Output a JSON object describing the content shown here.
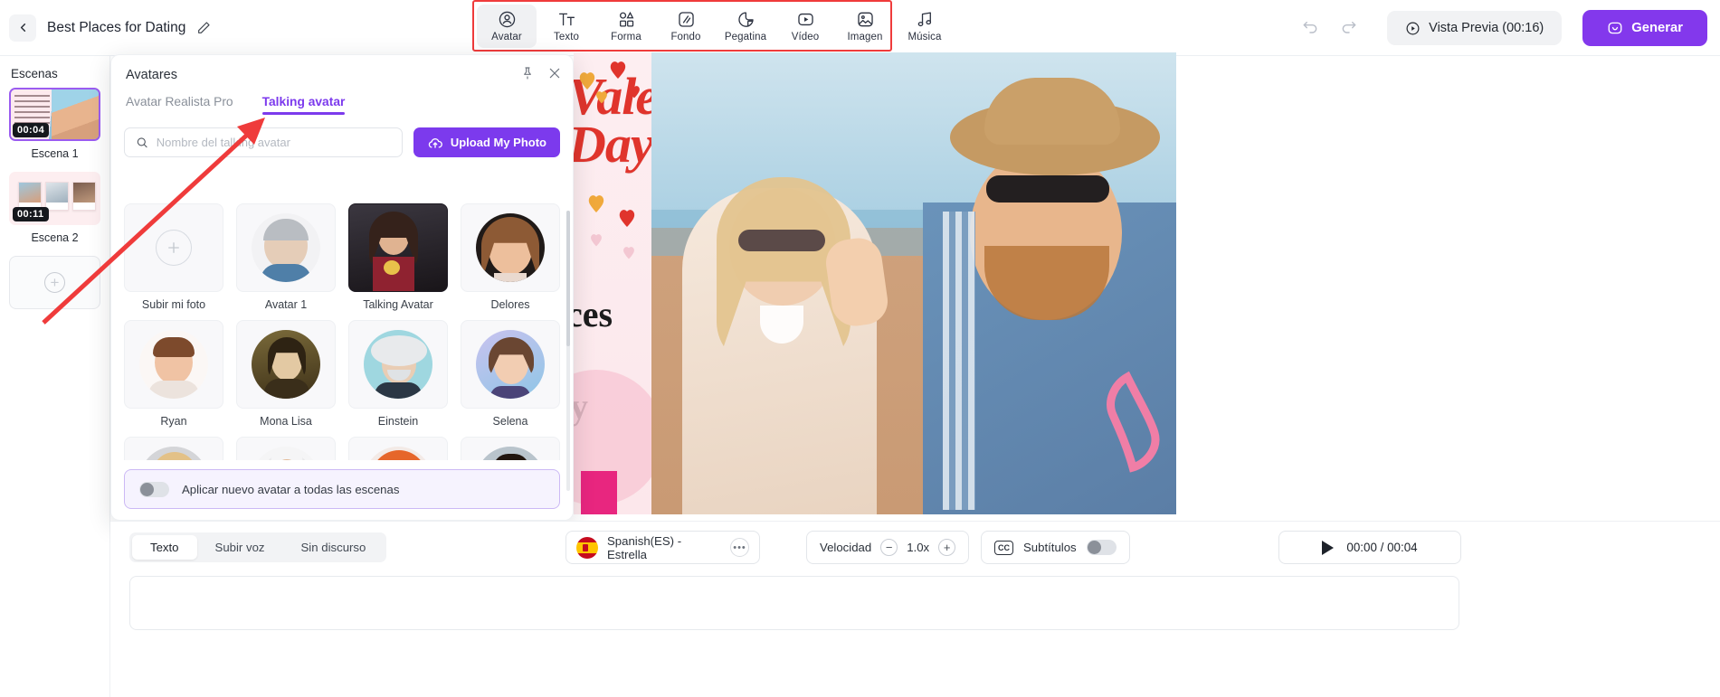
{
  "header": {
    "back_icon": "chevron-left-icon",
    "project_title": "Best Places for Dating",
    "edit_icon": "pencil-icon",
    "undo_icon": "undo-icon",
    "redo_icon": "redo-icon",
    "preview_label": "Vista Previa (00:16)",
    "preview_icon": "play-circle-icon",
    "generate_label": "Generar",
    "generate_icon": "sparkle-smile-icon",
    "accent_color": "#8338ec"
  },
  "toolbar": {
    "highlight_color": "#ef3b3b",
    "items": [
      {
        "label": "Avatar",
        "icon": "avatar-icon",
        "active": true
      },
      {
        "label": "Texto",
        "icon": "text-icon",
        "active": false
      },
      {
        "label": "Forma",
        "icon": "shape-icon",
        "active": false
      },
      {
        "label": "Fondo",
        "icon": "background-icon",
        "active": false
      },
      {
        "label": "Pegatina",
        "icon": "sticker-icon",
        "active": false
      },
      {
        "label": "Vídeo",
        "icon": "video-icon",
        "active": false
      },
      {
        "label": "Imagen",
        "icon": "image-icon",
        "active": false
      },
      {
        "label": "Música",
        "icon": "music-icon",
        "active": false
      }
    ]
  },
  "scenes": {
    "title": "Escenas",
    "items": [
      {
        "label": "Escena 1",
        "duration": "00:04",
        "selected": true
      },
      {
        "label": "Escena 2",
        "duration": "00:11",
        "selected": false
      }
    ],
    "add_label": "+",
    "selected_border_color": "#9b5cf0"
  },
  "avatar_panel": {
    "title": "Avatares",
    "pin_icon": "pin-icon",
    "close_icon": "close-icon",
    "tabs": [
      {
        "label": "Avatar Realista Pro",
        "active": false
      },
      {
        "label": "Talking avatar",
        "active": true
      }
    ],
    "search": {
      "placeholder": "Nombre del talking avatar",
      "value": "",
      "icon": "search-icon"
    },
    "upload_button": {
      "label": "Upload My Photo",
      "icon": "cloud-upload-icon"
    },
    "avatars": [
      {
        "name": "Subir mi foto",
        "kind": "upload"
      },
      {
        "name": "Avatar 1",
        "kind": "photo-man-elder"
      },
      {
        "name": "Talking Avatar",
        "kind": "photo-wonder-woman"
      },
      {
        "name": "Delores",
        "kind": "cartoon-woman-brown"
      },
      {
        "name": "Ryan",
        "kind": "cartoon-man-young"
      },
      {
        "name": "Mona Lisa",
        "kind": "painting-mona-lisa"
      },
      {
        "name": "Einstein",
        "kind": "photo-einstein"
      },
      {
        "name": "Selena",
        "kind": "cartoon-woman-bob"
      },
      {
        "name": "",
        "kind": "cartoon-girl-blonde"
      },
      {
        "name": "",
        "kind": "photo-woman-hijab"
      },
      {
        "name": "",
        "kind": "cartoon-woman-redhead"
      },
      {
        "name": "",
        "kind": "cartoon-man-yellow"
      }
    ],
    "apply_all": {
      "label": "Aplicar nuevo avatar a todas las escenas",
      "enabled": false
    }
  },
  "canvas": {
    "heading_line1": "Valentine's",
    "heading_line2": "Day",
    "body_line1": "ces",
    "body_line2": "y"
  },
  "bottom_bar": {
    "segments": [
      {
        "label": "Texto",
        "active": true
      },
      {
        "label": "Subir voz",
        "active": false
      },
      {
        "label": "Sin discurso",
        "active": false
      }
    ],
    "voice": {
      "label": "Spanish(ES) - Estrella",
      "flag": "spain-flag-icon",
      "more_icon": "more-dots-icon"
    },
    "speed": {
      "label": "Velocidad",
      "value": "1.0x",
      "minus": "−",
      "plus": "+"
    },
    "subtitles": {
      "label": "Subtítulos",
      "icon": "cc-icon",
      "enabled": false
    },
    "playback": {
      "icon": "play-icon",
      "time": "00:00 / 00:04"
    }
  }
}
